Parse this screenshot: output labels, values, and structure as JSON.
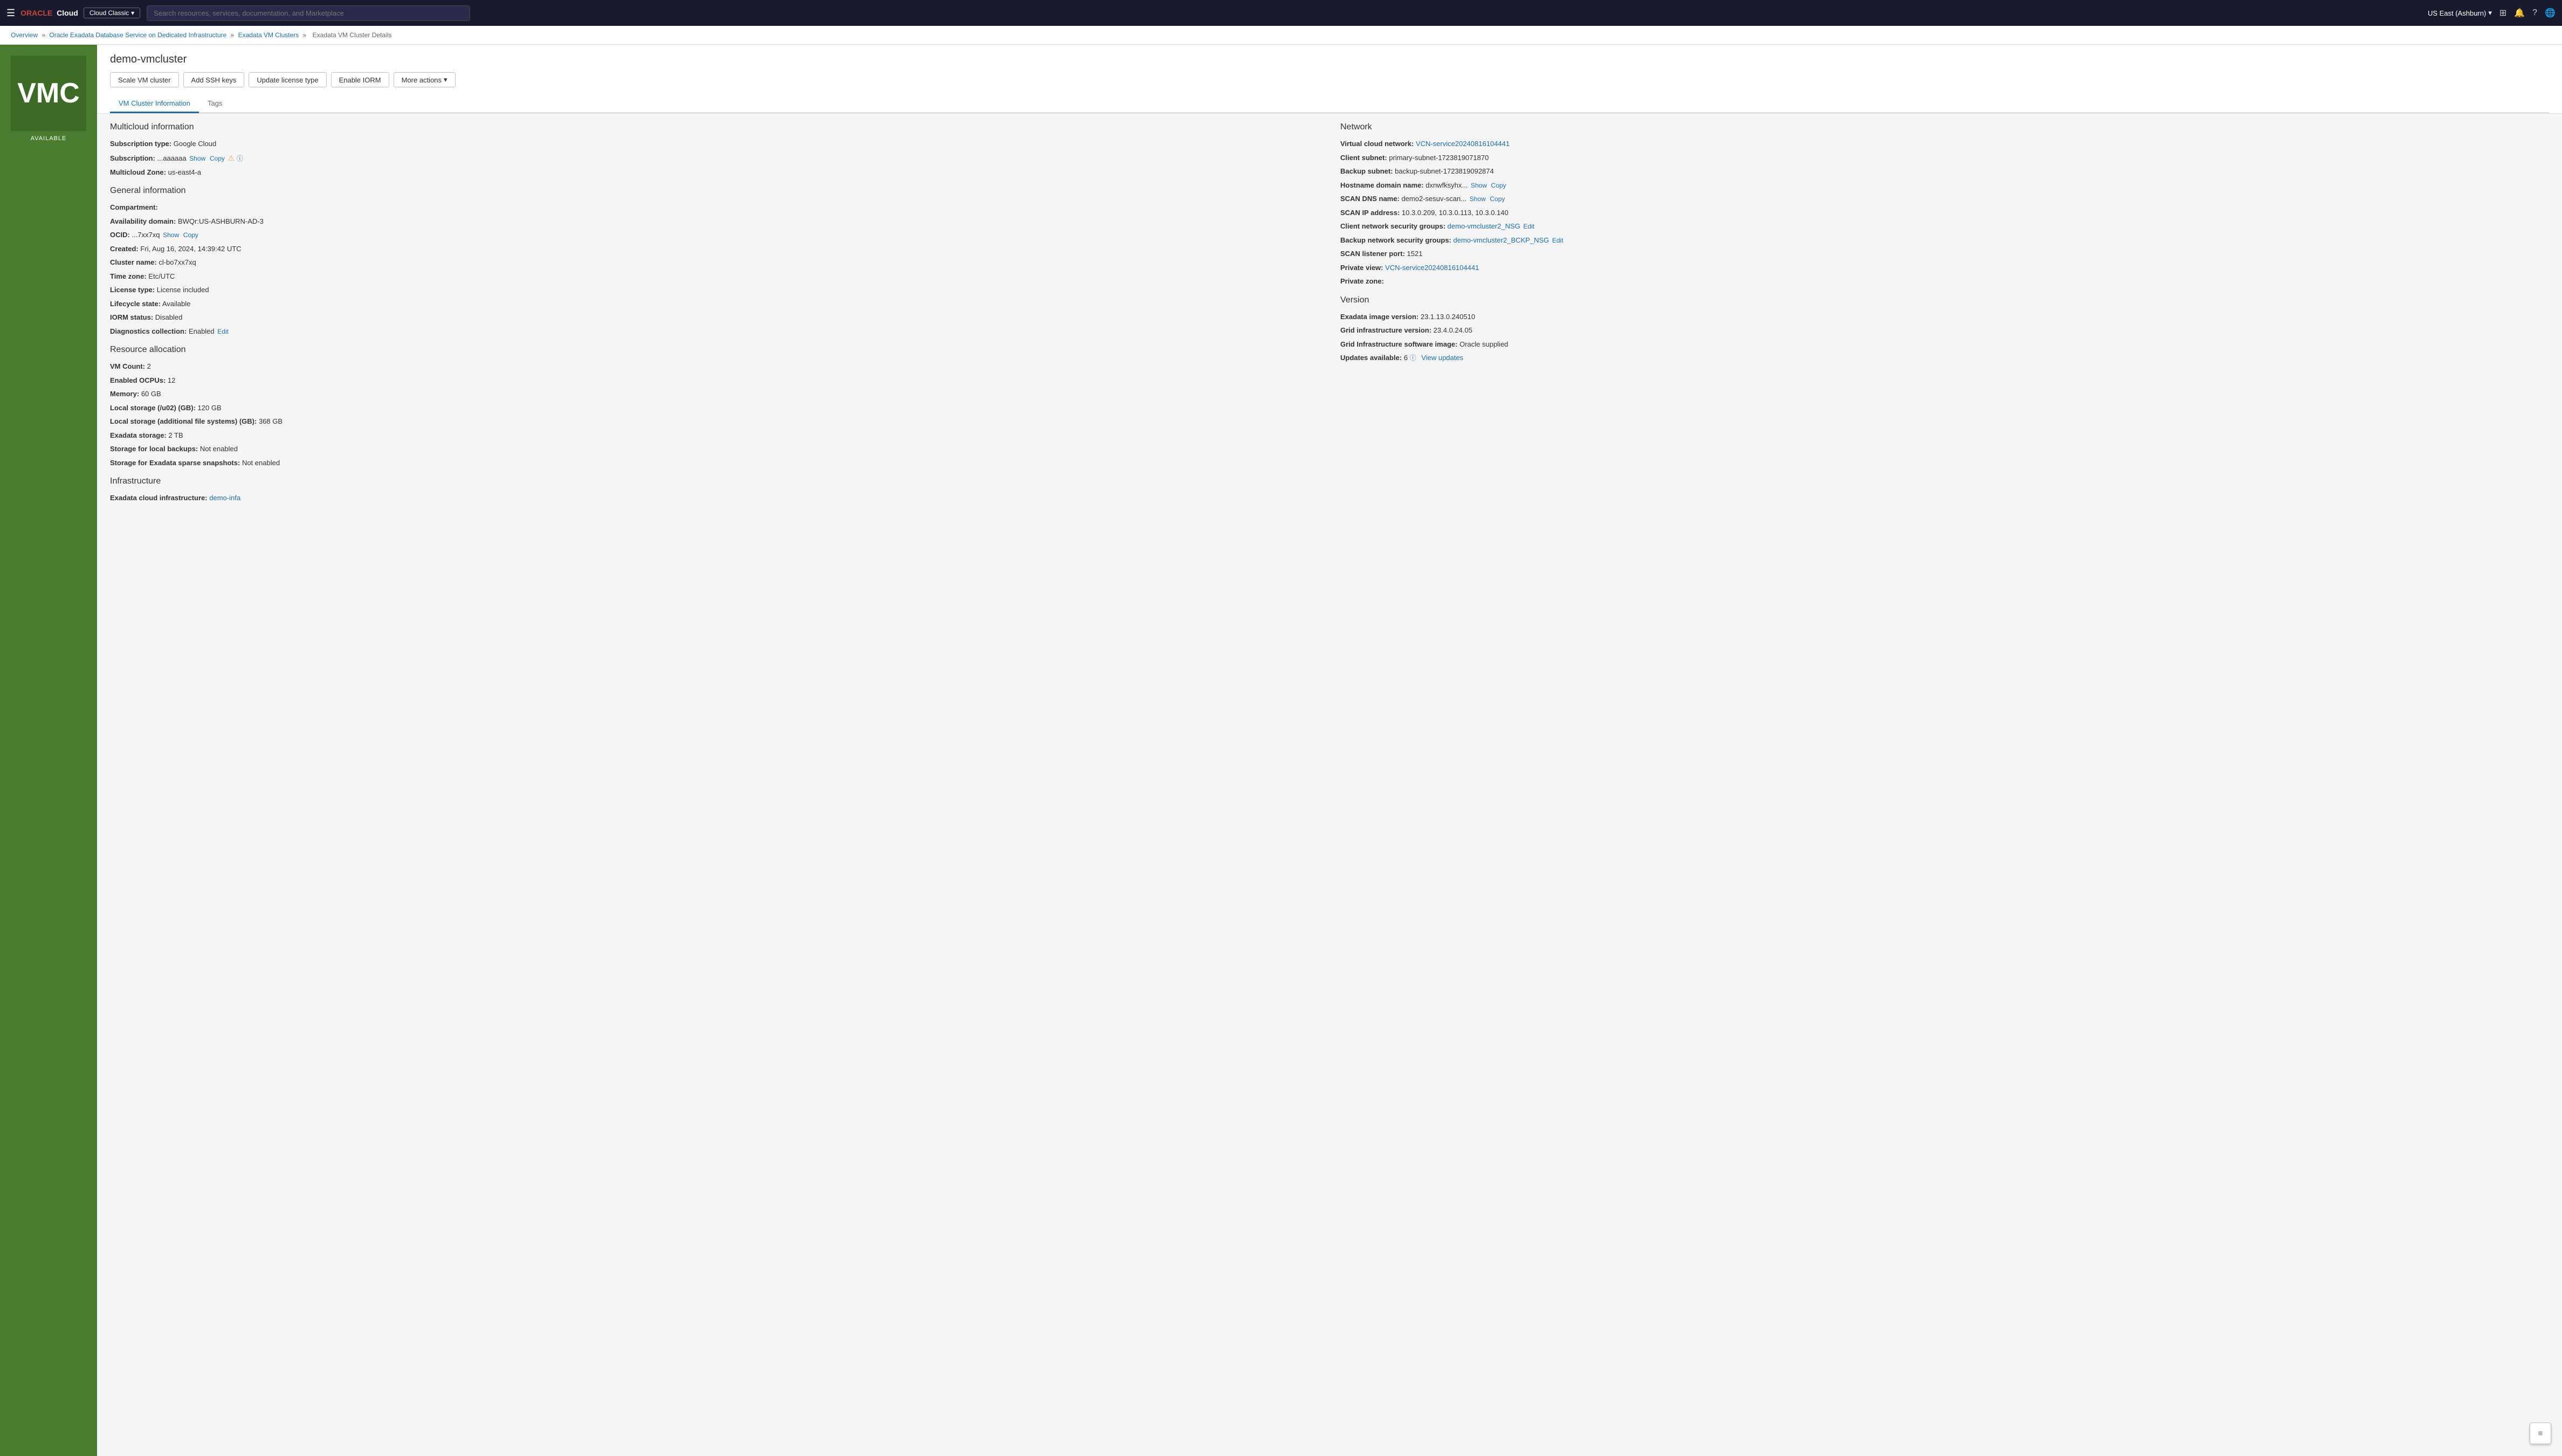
{
  "topnav": {
    "hamburger": "☰",
    "logo": "ORACLE Cloud",
    "cloud_badge": "Cloud Classic",
    "cloud_badge_arrow": "▾",
    "search_placeholder": "Search resources, services, documentation, and Marketplace",
    "region": "US East (Ashburn)",
    "region_arrow": "▾",
    "icons": [
      "⊞",
      "🔔",
      "?",
      "🌐"
    ]
  },
  "breadcrumb": {
    "items": [
      {
        "label": "Overview",
        "href": "#"
      },
      {
        "label": "Oracle Exadata Database Service on Dedicated Infrastructure",
        "href": "#"
      },
      {
        "label": "Exadata VM Clusters",
        "href": "#"
      },
      {
        "label": "Exadata VM Cluster Details",
        "href": null
      }
    ],
    "separator": "»"
  },
  "left_panel": {
    "initials": "VMC",
    "status": "AVAILABLE"
  },
  "page": {
    "title": "demo-vmcluster",
    "buttons": [
      {
        "label": "Scale VM cluster",
        "name": "scale-vm-cluster-button"
      },
      {
        "label": "Add SSH keys",
        "name": "add-ssh-keys-button"
      },
      {
        "label": "Update license type",
        "name": "update-license-type-button"
      },
      {
        "label": "Enable IORM",
        "name": "enable-iorm-button"
      },
      {
        "label": "More actions",
        "name": "more-actions-button",
        "has_arrow": true
      }
    ],
    "tabs": [
      {
        "label": "VM Cluster Information",
        "name": "tab-vm-cluster-info",
        "active": true
      },
      {
        "label": "Tags",
        "name": "tab-tags",
        "active": false
      }
    ]
  },
  "multicloud": {
    "section_title": "Multicloud information",
    "subscription_type_label": "Subscription type:",
    "subscription_type_value": "Google Cloud",
    "subscription_label": "Subscription:",
    "subscription_value": "...aaaaaa",
    "subscription_show": "Show",
    "subscription_copy": "Copy",
    "multicloud_zone_label": "Multicloud Zone:",
    "multicloud_zone_value": "us-east4-a"
  },
  "general": {
    "section_title": "General information",
    "compartment_label": "Compartment:",
    "compartment_value": "",
    "availability_domain_label": "Availability domain:",
    "availability_domain_value": "BWQr:US-ASHBURN-AD-3",
    "ocid_label": "OCID:",
    "ocid_value": "...7xx7xq",
    "ocid_show": "Show",
    "ocid_copy": "Copy",
    "created_label": "Created:",
    "created_value": "Fri, Aug 16, 2024, 14:39:42 UTC",
    "cluster_name_label": "Cluster name:",
    "cluster_name_value": "cl-bo7xx7xq",
    "time_zone_label": "Time zone:",
    "time_zone_value": "Etc/UTC",
    "license_type_label": "License type:",
    "license_type_value": "License included",
    "lifecycle_state_label": "Lifecycle state:",
    "lifecycle_state_value": "Available",
    "iorm_status_label": "IORM status:",
    "iorm_status_value": "Disabled",
    "diagnostics_label": "Diagnostics collection:",
    "diagnostics_value": "Enabled",
    "diagnostics_edit": "Edit"
  },
  "resource_allocation": {
    "section_title": "Resource allocation",
    "vm_count_label": "VM Count:",
    "vm_count_value": "2",
    "enabled_ocpus_label": "Enabled OCPUs:",
    "enabled_ocpus_value": "12",
    "memory_label": "Memory:",
    "memory_value": "60 GB",
    "local_storage_u02_label": "Local storage (/u02) (GB):",
    "local_storage_u02_value": "120 GB",
    "local_storage_afs_label": "Local storage (additional file systems) (GB):",
    "local_storage_afs_value": "368 GB",
    "exadata_storage_label": "Exadata storage:",
    "exadata_storage_value": "2 TB",
    "local_backups_label": "Storage for local backups:",
    "local_backups_value": "Not enabled",
    "sparse_snapshots_label": "Storage for Exadata sparse snapshots:",
    "sparse_snapshots_value": "Not enabled"
  },
  "infrastructure": {
    "section_title": "Infrastructure",
    "exadata_cloud_label": "Exadata cloud infrastructure:",
    "exadata_cloud_link": "demo-infa"
  },
  "network": {
    "section_title": "Network",
    "vcn_label": "Virtual cloud network:",
    "vcn_link": "VCN-service20240816104441",
    "client_subnet_label": "Client subnet:",
    "client_subnet_value": "primary-subnet-1723819071870",
    "backup_subnet_label": "Backup subnet:",
    "backup_subnet_value": "backup-subnet-1723819092874",
    "hostname_label": "Hostname domain name:",
    "hostname_value": "dxnwfksyhx...",
    "hostname_show": "Show",
    "hostname_copy": "Copy",
    "scan_dns_label": "SCAN DNS name:",
    "scan_dns_value": "demo2-sesuv-scan...",
    "scan_dns_show": "Show",
    "scan_dns_copy": "Copy",
    "scan_ip_label": "SCAN IP address:",
    "scan_ip_value": "10.3.0.209, 10.3.0.113, 10.3.0.140",
    "client_nsg_label": "Client network security groups:",
    "client_nsg_link": "demo-vmcluster2_NSG",
    "client_nsg_edit": "Edit",
    "backup_nsg_label": "Backup network security groups:",
    "backup_nsg_link": "demo-vmcluster2_BCKP_NSG",
    "backup_nsg_edit": "Edit",
    "scan_listener_label": "SCAN listener port:",
    "scan_listener_value": "1521",
    "private_view_label": "Private view:",
    "private_view_link": "VCN-service20240816104441",
    "private_zone_label": "Private zone:",
    "private_zone_value": ""
  },
  "version": {
    "section_title": "Version",
    "exadata_image_label": "Exadata image version:",
    "exadata_image_value": "23.1.13.0.240510",
    "grid_infra_label": "Grid infrastructure version:",
    "grid_infra_value": "23.4.0.24.05",
    "grid_software_label": "Grid Infrastructure software image:",
    "grid_software_value": "Oracle supplied",
    "updates_label": "Updates available:",
    "updates_count": "6",
    "updates_link": "View updates"
  }
}
